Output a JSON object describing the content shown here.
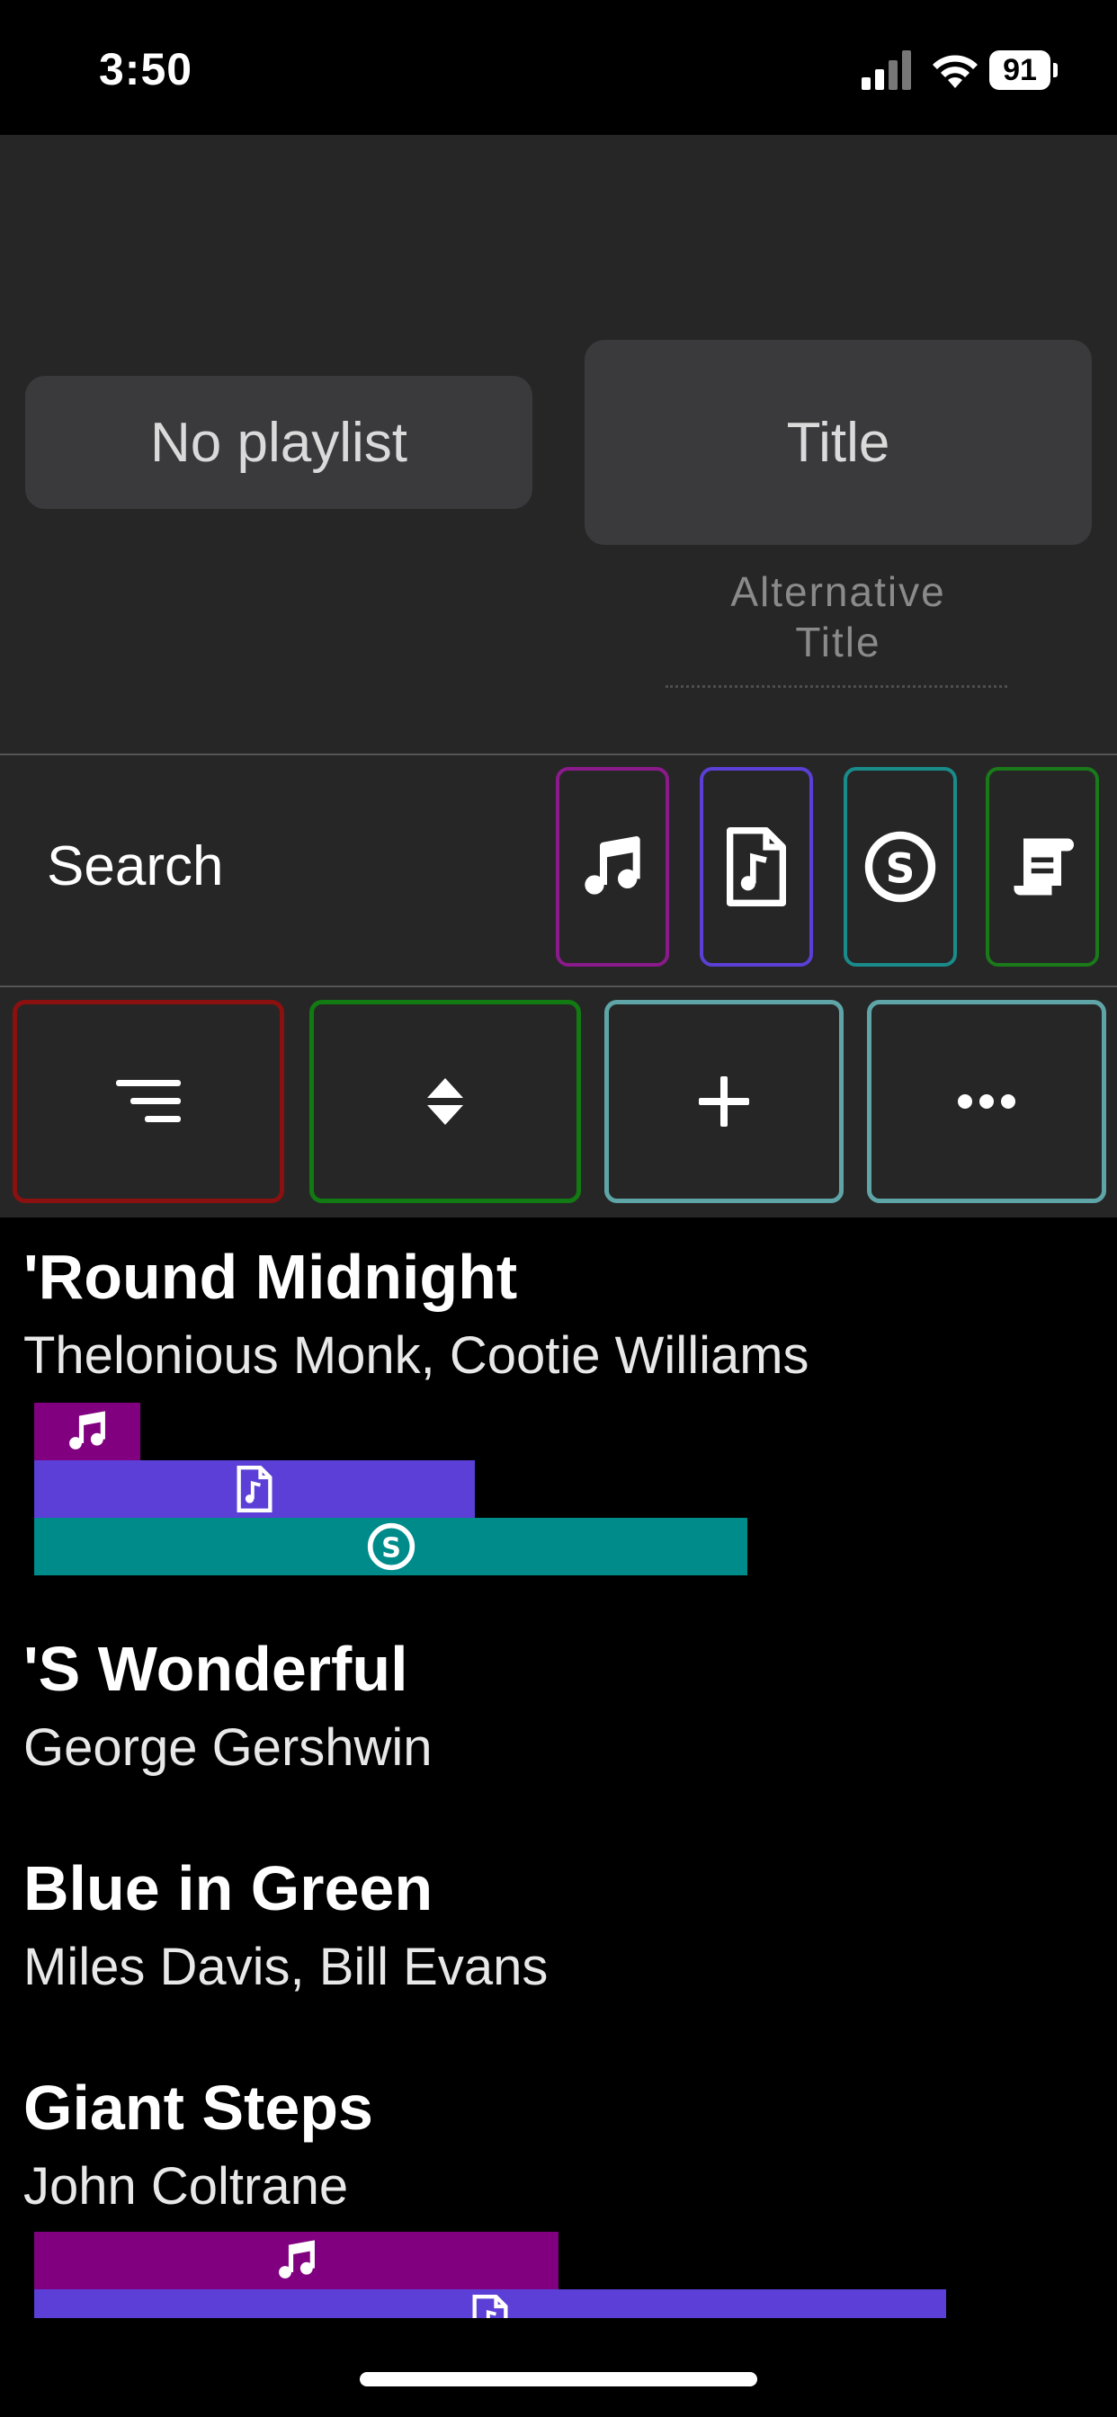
{
  "status": {
    "time": "3:50",
    "battery": "91"
  },
  "header": {
    "playlist_label": "No playlist",
    "title_label": "Title",
    "alt_title_line1": "Alternative",
    "alt_title_line2": "Title"
  },
  "search": {
    "label": "Search",
    "filters": [
      {
        "icon": "music-note-icon",
        "color": "#8b1a8b"
      },
      {
        "icon": "file-music-icon",
        "color": "#5b3fd6"
      },
      {
        "icon": "spotify-s-icon",
        "color": "#1a8b8b"
      },
      {
        "icon": "scroll-icon",
        "color": "#1a7a1a"
      }
    ]
  },
  "toolbar": {
    "buttons": [
      {
        "icon": "sort-lines-icon",
        "color": "#8b1010"
      },
      {
        "icon": "sort-updown-icon",
        "color": "#127a12"
      },
      {
        "icon": "plus-icon",
        "color": "#5fa5a8"
      },
      {
        "icon": "more-icon",
        "color": "#5fa5a8"
      }
    ]
  },
  "colors": {
    "music_bar": "#800080",
    "file_bar": "#5b3fd6",
    "s_bar": "#008b8b"
  },
  "songs": [
    {
      "title": "'Round Midnight",
      "artist": "Thelonious Monk, Cootie Williams"
    },
    {
      "title": "'S Wonderful",
      "artist": "George Gershwin"
    },
    {
      "title": "Blue in Green",
      "artist": "Miles Davis, Bill Evans"
    },
    {
      "title": "Giant Steps",
      "artist": "John Coltrane"
    }
  ]
}
